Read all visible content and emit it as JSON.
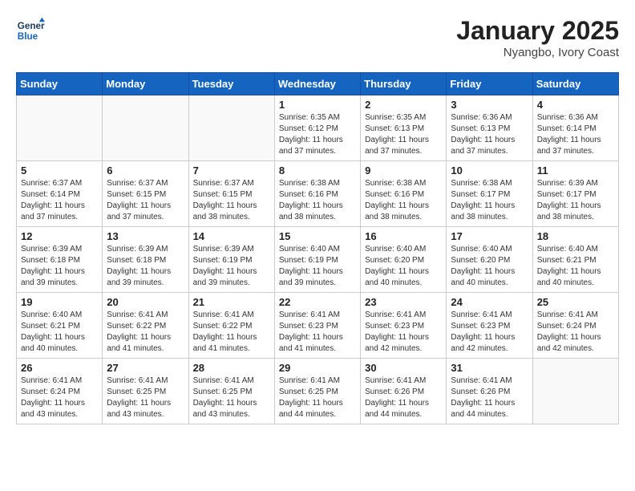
{
  "logo": {
    "line1": "General",
    "line2": "Blue"
  },
  "title": "January 2025",
  "location": "Nyangbo, Ivory Coast",
  "weekdays": [
    "Sunday",
    "Monday",
    "Tuesday",
    "Wednesday",
    "Thursday",
    "Friday",
    "Saturday"
  ],
  "weeks": [
    [
      {
        "day": "",
        "info": ""
      },
      {
        "day": "",
        "info": ""
      },
      {
        "day": "",
        "info": ""
      },
      {
        "day": "1",
        "info": "Sunrise: 6:35 AM\nSunset: 6:12 PM\nDaylight: 11 hours\nand 37 minutes."
      },
      {
        "day": "2",
        "info": "Sunrise: 6:35 AM\nSunset: 6:13 PM\nDaylight: 11 hours\nand 37 minutes."
      },
      {
        "day": "3",
        "info": "Sunrise: 6:36 AM\nSunset: 6:13 PM\nDaylight: 11 hours\nand 37 minutes."
      },
      {
        "day": "4",
        "info": "Sunrise: 6:36 AM\nSunset: 6:14 PM\nDaylight: 11 hours\nand 37 minutes."
      }
    ],
    [
      {
        "day": "5",
        "info": "Sunrise: 6:37 AM\nSunset: 6:14 PM\nDaylight: 11 hours\nand 37 minutes."
      },
      {
        "day": "6",
        "info": "Sunrise: 6:37 AM\nSunset: 6:15 PM\nDaylight: 11 hours\nand 37 minutes."
      },
      {
        "day": "7",
        "info": "Sunrise: 6:37 AM\nSunset: 6:15 PM\nDaylight: 11 hours\nand 38 minutes."
      },
      {
        "day": "8",
        "info": "Sunrise: 6:38 AM\nSunset: 6:16 PM\nDaylight: 11 hours\nand 38 minutes."
      },
      {
        "day": "9",
        "info": "Sunrise: 6:38 AM\nSunset: 6:16 PM\nDaylight: 11 hours\nand 38 minutes."
      },
      {
        "day": "10",
        "info": "Sunrise: 6:38 AM\nSunset: 6:17 PM\nDaylight: 11 hours\nand 38 minutes."
      },
      {
        "day": "11",
        "info": "Sunrise: 6:39 AM\nSunset: 6:17 PM\nDaylight: 11 hours\nand 38 minutes."
      }
    ],
    [
      {
        "day": "12",
        "info": "Sunrise: 6:39 AM\nSunset: 6:18 PM\nDaylight: 11 hours\nand 39 minutes."
      },
      {
        "day": "13",
        "info": "Sunrise: 6:39 AM\nSunset: 6:18 PM\nDaylight: 11 hours\nand 39 minutes."
      },
      {
        "day": "14",
        "info": "Sunrise: 6:39 AM\nSunset: 6:19 PM\nDaylight: 11 hours\nand 39 minutes."
      },
      {
        "day": "15",
        "info": "Sunrise: 6:40 AM\nSunset: 6:19 PM\nDaylight: 11 hours\nand 39 minutes."
      },
      {
        "day": "16",
        "info": "Sunrise: 6:40 AM\nSunset: 6:20 PM\nDaylight: 11 hours\nand 40 minutes."
      },
      {
        "day": "17",
        "info": "Sunrise: 6:40 AM\nSunset: 6:20 PM\nDaylight: 11 hours\nand 40 minutes."
      },
      {
        "day": "18",
        "info": "Sunrise: 6:40 AM\nSunset: 6:21 PM\nDaylight: 11 hours\nand 40 minutes."
      }
    ],
    [
      {
        "day": "19",
        "info": "Sunrise: 6:40 AM\nSunset: 6:21 PM\nDaylight: 11 hours\nand 40 minutes."
      },
      {
        "day": "20",
        "info": "Sunrise: 6:41 AM\nSunset: 6:22 PM\nDaylight: 11 hours\nand 41 minutes."
      },
      {
        "day": "21",
        "info": "Sunrise: 6:41 AM\nSunset: 6:22 PM\nDaylight: 11 hours\nand 41 minutes."
      },
      {
        "day": "22",
        "info": "Sunrise: 6:41 AM\nSunset: 6:23 PM\nDaylight: 11 hours\nand 41 minutes."
      },
      {
        "day": "23",
        "info": "Sunrise: 6:41 AM\nSunset: 6:23 PM\nDaylight: 11 hours\nand 42 minutes."
      },
      {
        "day": "24",
        "info": "Sunrise: 6:41 AM\nSunset: 6:23 PM\nDaylight: 11 hours\nand 42 minutes."
      },
      {
        "day": "25",
        "info": "Sunrise: 6:41 AM\nSunset: 6:24 PM\nDaylight: 11 hours\nand 42 minutes."
      }
    ],
    [
      {
        "day": "26",
        "info": "Sunrise: 6:41 AM\nSunset: 6:24 PM\nDaylight: 11 hours\nand 43 minutes."
      },
      {
        "day": "27",
        "info": "Sunrise: 6:41 AM\nSunset: 6:25 PM\nDaylight: 11 hours\nand 43 minutes."
      },
      {
        "day": "28",
        "info": "Sunrise: 6:41 AM\nSunset: 6:25 PM\nDaylight: 11 hours\nand 43 minutes."
      },
      {
        "day": "29",
        "info": "Sunrise: 6:41 AM\nSunset: 6:25 PM\nDaylight: 11 hours\nand 44 minutes."
      },
      {
        "day": "30",
        "info": "Sunrise: 6:41 AM\nSunset: 6:26 PM\nDaylight: 11 hours\nand 44 minutes."
      },
      {
        "day": "31",
        "info": "Sunrise: 6:41 AM\nSunset: 6:26 PM\nDaylight: 11 hours\nand 44 minutes."
      },
      {
        "day": "",
        "info": ""
      }
    ]
  ]
}
